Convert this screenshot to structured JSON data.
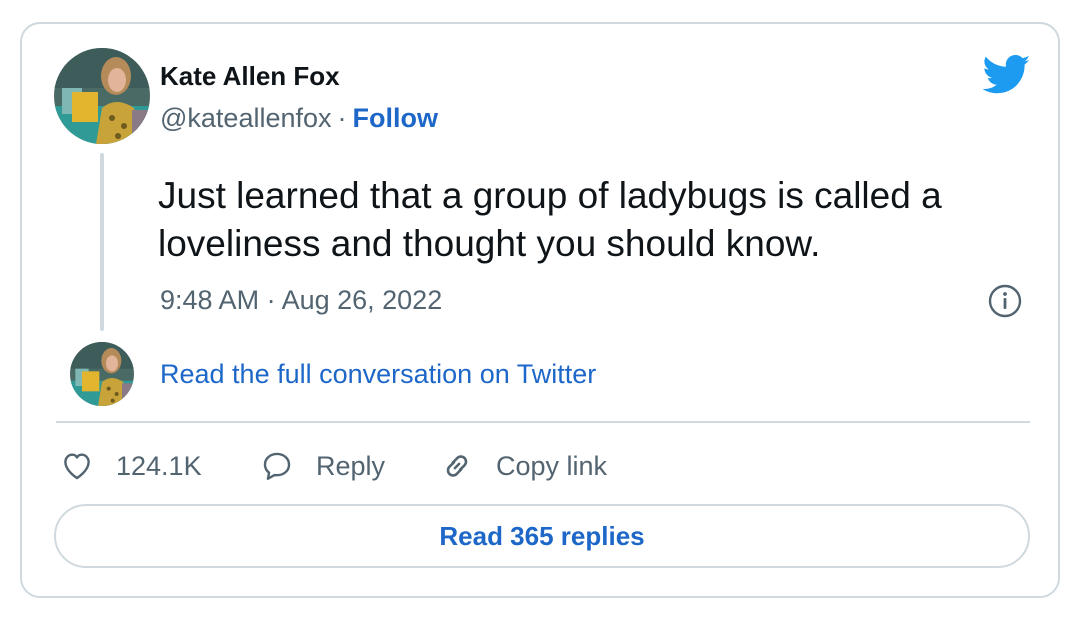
{
  "tweet": {
    "author_name": "Kate Allen Fox",
    "handle": "@kateallenfox",
    "separator": "·",
    "follow_label": "Follow",
    "text": "Just learned that a group of ladybugs is called a loveliness and thought you should know.",
    "timestamp": "9:48 AM · Aug 26, 2022"
  },
  "conversation": {
    "link_text": "Read the full conversation on Twitter"
  },
  "actions": {
    "like_count": "124.1K",
    "reply_label": "Reply",
    "copy_link_label": "Copy link"
  },
  "replies_button_label": "Read 365 replies",
  "icons": {
    "brand": "twitter-bird-icon",
    "info": "info-icon",
    "like": "heart-icon",
    "reply": "speech-bubble-icon",
    "copy": "link-icon"
  },
  "colors": {
    "link_blue": "#1d67c8",
    "twitter_blue": "#1d9bf0",
    "secondary_text": "#536471",
    "border": "#cfd9de",
    "text": "#0f1419"
  }
}
